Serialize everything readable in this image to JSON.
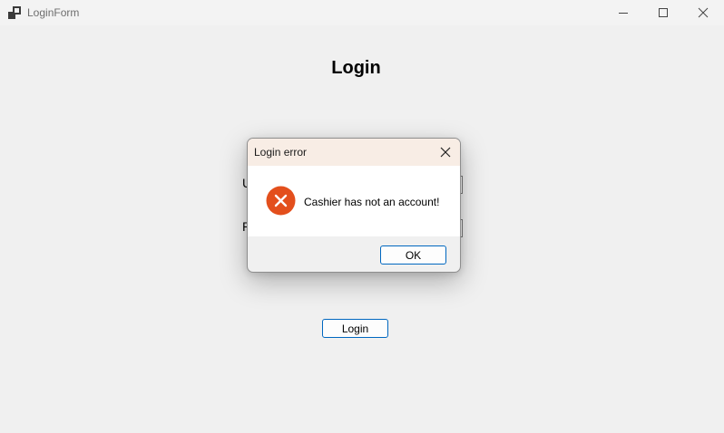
{
  "window": {
    "title": "LoginForm",
    "icon": "app-window-icon"
  },
  "form": {
    "heading": "Login",
    "username_label": "U",
    "password_label": "P",
    "username_value": "",
    "password_value": "",
    "login_button": "Login"
  },
  "dialog": {
    "title": "Login error",
    "message": "Cashier has not an account!",
    "icon": "error-icon",
    "ok_button": "OK"
  },
  "colors": {
    "accent": "#0067c0",
    "error": "#e34f1c",
    "dialog_titlebar": "#f8ede5"
  }
}
